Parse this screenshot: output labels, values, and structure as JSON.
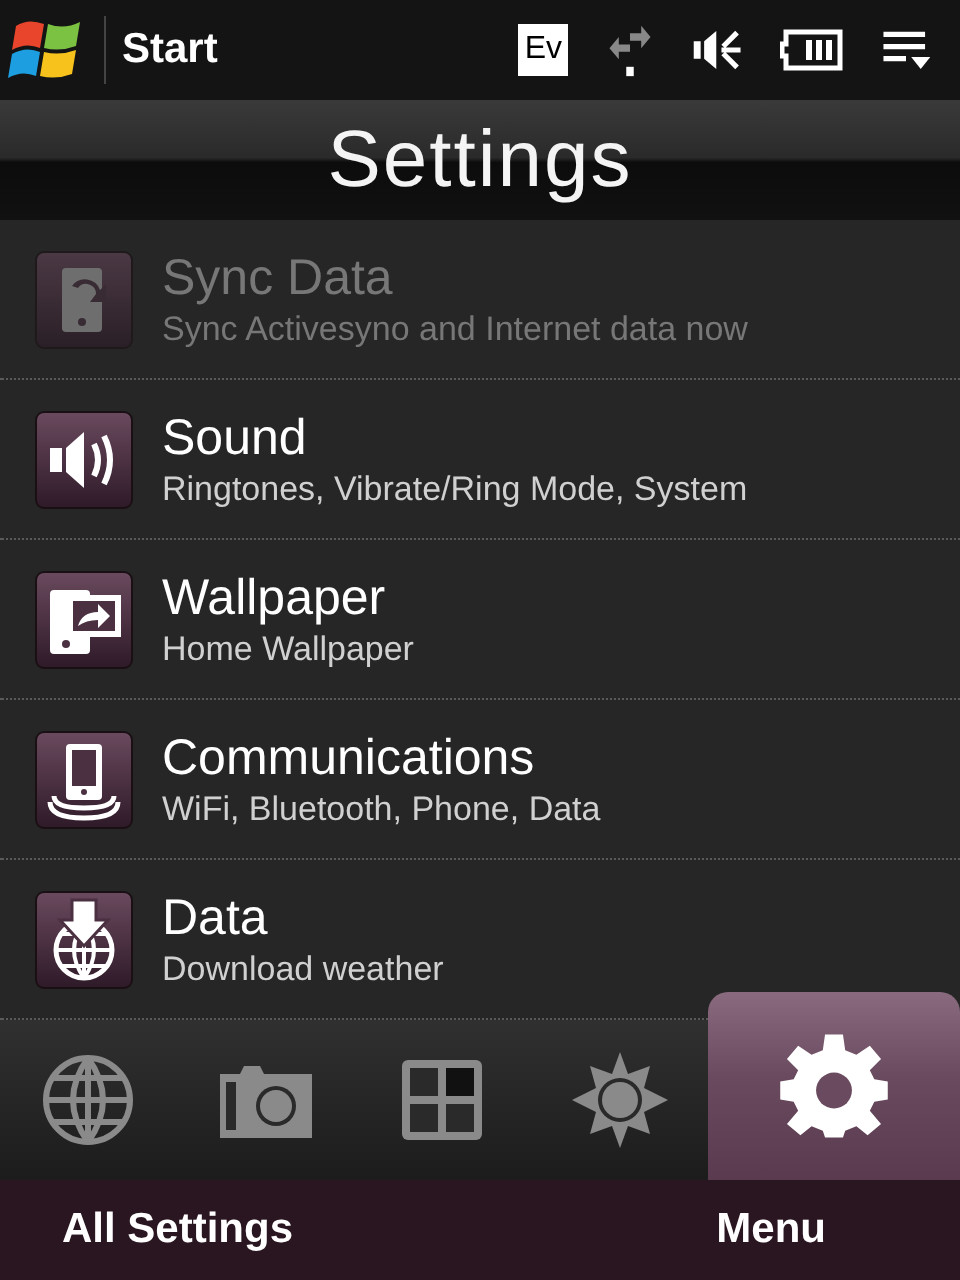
{
  "status_bar": {
    "start_label": "Start",
    "badge": "Ev"
  },
  "title": "Settings",
  "items": [
    {
      "kind": "sync",
      "title": "Sync Data",
      "subtitle": "Sync Activesyno and Internet data now",
      "disabled": true
    },
    {
      "kind": "sound",
      "title": "Sound",
      "subtitle": "Ringtones, Vibrate/Ring Mode, System",
      "disabled": false
    },
    {
      "kind": "wallpaper",
      "title": "Wallpaper",
      "subtitle": "Home Wallpaper",
      "disabled": false
    },
    {
      "kind": "communications",
      "title": "Communications",
      "subtitle": "WiFi, Bluetooth, Phone, Data",
      "disabled": false
    },
    {
      "kind": "data",
      "title": "Data",
      "subtitle": "Download weather",
      "disabled": false
    }
  ],
  "tabs": [
    {
      "kind": "globe",
      "selected": false
    },
    {
      "kind": "camera",
      "selected": false
    },
    {
      "kind": "grid",
      "selected": false
    },
    {
      "kind": "sun",
      "selected": false
    },
    {
      "kind": "gear",
      "selected": true
    }
  ],
  "softkeys": {
    "left": "All Settings",
    "right": "Menu"
  }
}
